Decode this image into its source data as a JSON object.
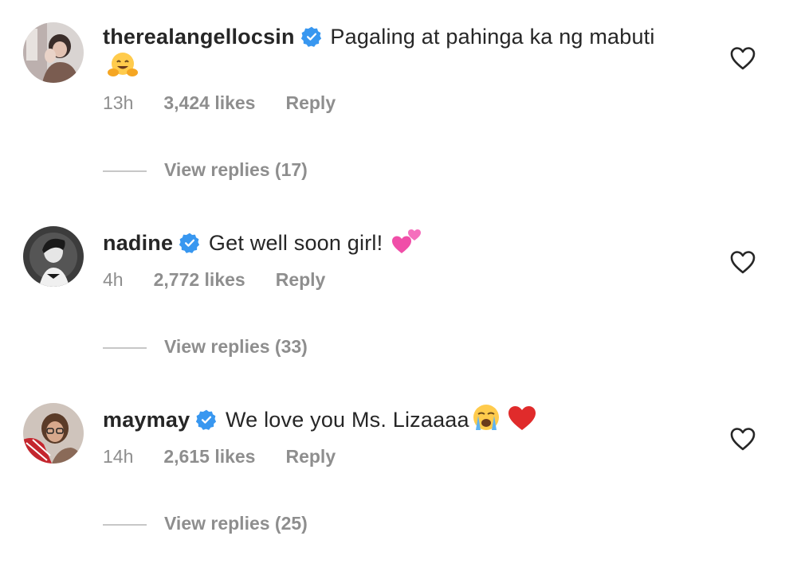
{
  "comments": [
    {
      "username": "therealangellocsin",
      "text": "Pagaling at pahinga ka ng mabuti",
      "emoji": [
        "hugging-face-emoji"
      ],
      "time": "13h",
      "likes": "3,424 likes",
      "reply_label": "Reply",
      "view_replies": "View replies (17)"
    },
    {
      "username": "nadine",
      "text": "Get well soon girl!",
      "emoji": [
        "two-hearts-emoji"
      ],
      "time": "4h",
      "likes": "2,772 likes",
      "reply_label": "Reply",
      "view_replies": "View replies (33)"
    },
    {
      "username": "maymay",
      "text": "We love you Ms. Lizaaaa",
      "emoji": [
        "loudly-crying-face-emoji",
        "red-heart-emoji"
      ],
      "time": "14h",
      "likes": "2,615 likes",
      "reply_label": "Reply",
      "view_replies": "View replies (25)"
    }
  ],
  "icons": {
    "verified": "verified-badge-icon",
    "like": "heart-outline-icon"
  },
  "colors": {
    "text": "#262626",
    "secondary": "#8e8e8e",
    "verified": "#3897f0",
    "divider": "#c7c7c7"
  }
}
